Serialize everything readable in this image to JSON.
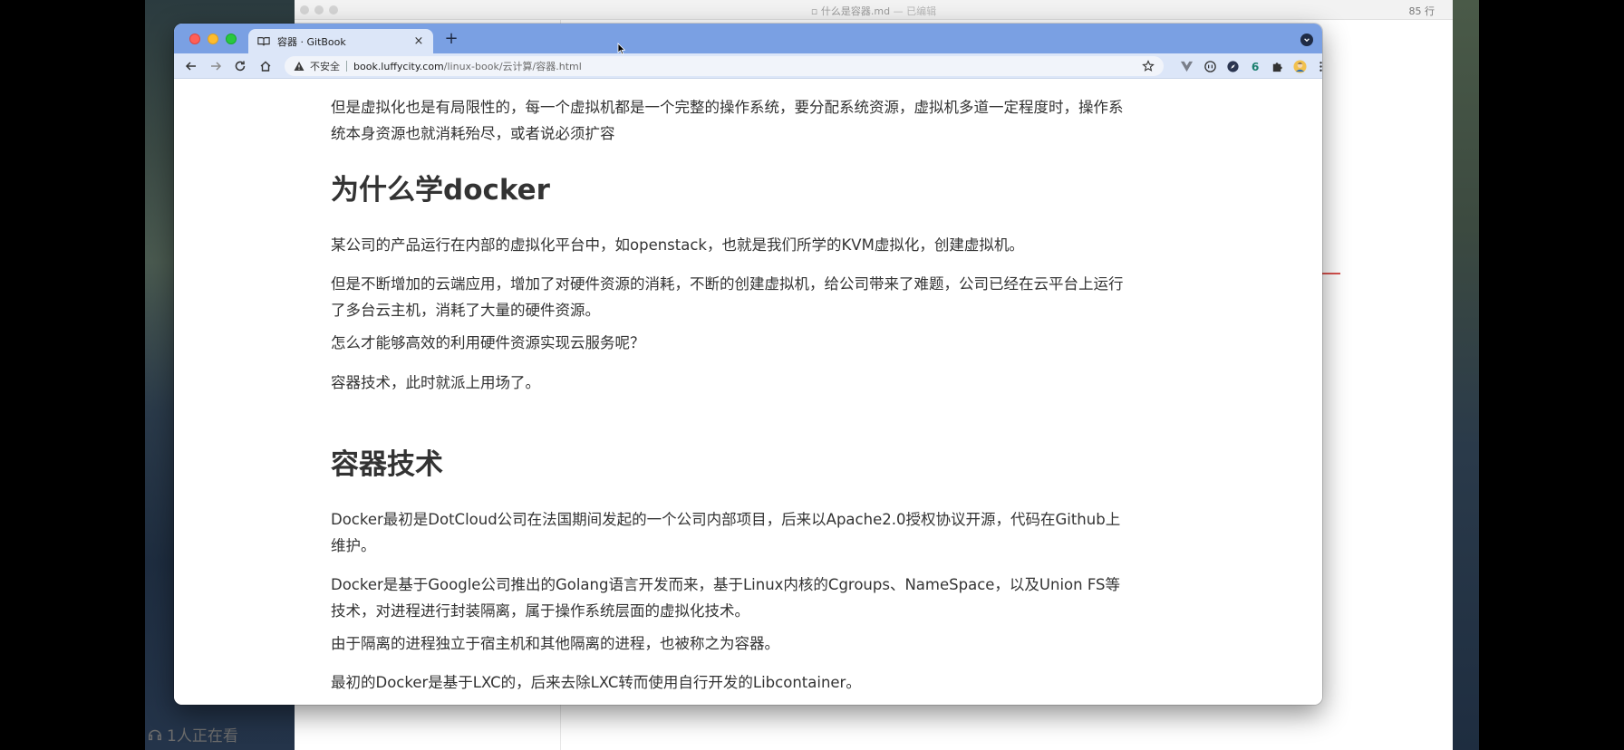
{
  "background_editor": {
    "title": "什么是容器.md",
    "edited": "— 已编辑",
    "line_count": "85 行"
  },
  "watching": {
    "text": "1人正在看"
  },
  "browser": {
    "tab": {
      "title": "容器 · GitBook",
      "close": "×"
    },
    "new_tab": "+",
    "omnibox": {
      "security_label": "不安全",
      "host": "book.luffycity.com",
      "path": "/linux-book/云计算/容器.html"
    }
  },
  "page": {
    "para_intro": "但是虚拟化也是有局限性的，每一个虚拟机都是一个完整的操作系统，要分配系统资源，虚拟机多道一定程度时，操作系统本身资源也就消耗殆尽，或者说必须扩容",
    "heading_why": "为什么学docker",
    "para_why_1": "某公司的产品运行在内部的虚拟化平台中，如openstack，也就是我们所学的KVM虚拟化，创建虚拟机。",
    "para_why_2": "但是不断增加的云端应用，增加了对硬件资源的消耗，不断的创建虚拟机，给公司带来了难题，公司已经在云平台上运行了多台云主机，消耗了大量的硬件资源。",
    "para_why_3": "怎么才能够高效的利用硬件资源实现云服务呢？",
    "para_why_4": "容器技术，此时就派上用场了。",
    "heading_container": "容器技术",
    "para_container_1": "Docker最初是DotCloud公司在法国期间发起的一个公司内部项目，后来以Apache2.0授权协议开源，代码在Github上维护。",
    "para_container_2": "Docker是基于Google公司推出的Golang语言开发而来，基于Linux内核的Cgroups、NameSpace，以及Union FS等技术，对进程进行封装隔离，属于操作系统层面的虚拟化技术。",
    "para_container_3": "由于隔离的进程独立于宿主机和其他隔离的进程，也被称之为容器。",
    "para_container_4": "最初的Docker是基于LXC的，后来去除LXC转而使用自行开发的Libcontainer。"
  },
  "colors": {
    "tabstrip": "#7aa0e3",
    "toolbar": "#dce6f8",
    "text": "#333333"
  }
}
